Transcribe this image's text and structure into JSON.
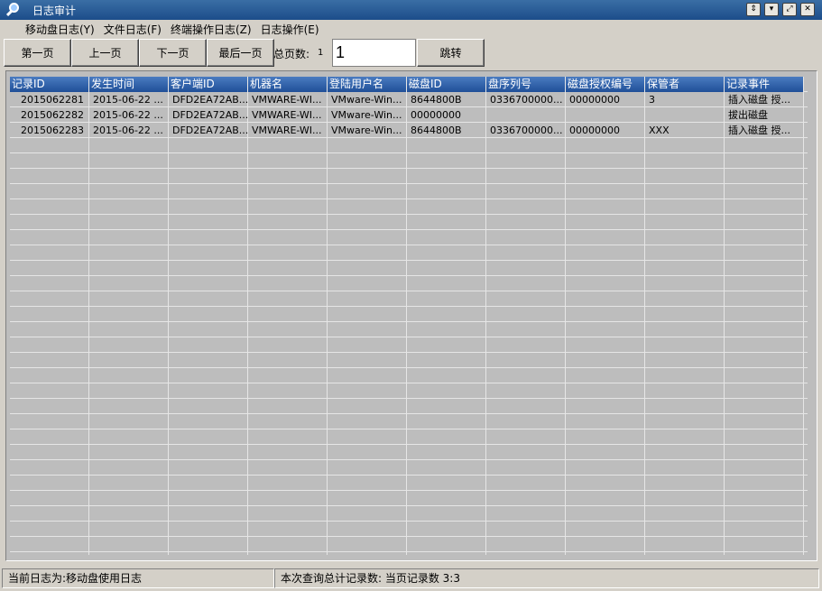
{
  "window": {
    "title": "日志审计"
  },
  "menu": [
    "移动盘日志(Y)",
    "文件日志(F)",
    "终端操作日志(Z)",
    "日志操作(E)"
  ],
  "toolbar": {
    "first": "第一页",
    "prev": "上一页",
    "next": "下一页",
    "last": "最后一页",
    "total_pages_label": "总页数:",
    "total_pages": "1",
    "page_input": "1",
    "goto": "跳转"
  },
  "table": {
    "columns": [
      "记录ID",
      "发生时间",
      "客户端ID",
      "机器名",
      "登陆用户名",
      "磁盘ID",
      "盘序列号",
      "磁盘授权编号",
      "保管者",
      "记录事件"
    ],
    "rows": [
      [
        "2015062281",
        "2015-06-22 ...",
        "DFD2EA72AB...",
        "VMWARE-WI...",
        "VMware-Win...",
        "8644800B",
        "0336700000...",
        "00000000",
        "3",
        "插入磁盘 授..."
      ],
      [
        "2015062282",
        "2015-06-22 ...",
        "DFD2EA72AB...",
        "VMWARE-WI...",
        "VMware-Win...",
        "00000000",
        "",
        "",
        "",
        "拔出磁盘"
      ],
      [
        "2015062283",
        "2015-06-22 ...",
        "DFD2EA72AB...",
        "VMWARE-WI...",
        "VMware-Win...",
        "8644800B",
        "0336700000...",
        "00000000",
        "XXX",
        "插入磁盘 授..."
      ]
    ]
  },
  "status": {
    "current_log": "当前日志为:移动盘使用日志",
    "records": "本次查询总计记录数: 当页记录数 3:3"
  }
}
